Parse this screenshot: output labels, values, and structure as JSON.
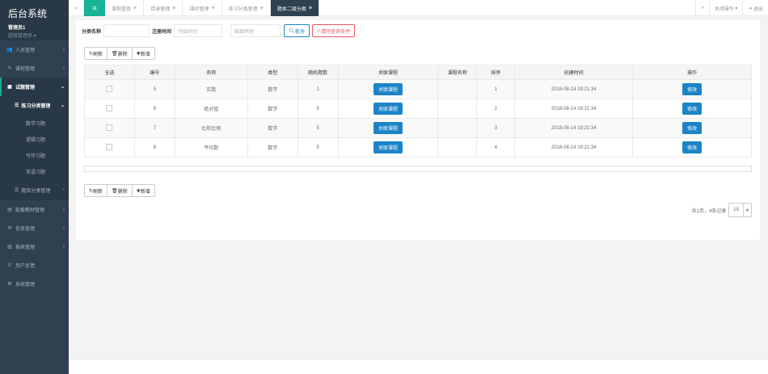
{
  "sidebar": {
    "title": "后台系统",
    "user": "管理员1",
    "role": "超级管理员 ▾",
    "items": [
      {
        "label": "人员管理",
        "icon": "👥"
      },
      {
        "label": "课程管理",
        "icon": "✎"
      },
      {
        "label": "试题管理",
        "icon": "▣"
      }
    ],
    "sub_head": "练习分类管理",
    "sub_items": [
      "数学习题",
      "逻辑习题",
      "写作习题",
      "英语习题"
    ],
    "sub_head2": "题库分类管理",
    "items2": [
      {
        "label": "配套教材管理",
        "icon": "▤"
      },
      {
        "label": "信息管理",
        "icon": "✉"
      },
      {
        "label": "报表管理",
        "icon": "▥"
      },
      {
        "label": "用户反馈",
        "icon": "✆"
      },
      {
        "label": "系统管理",
        "icon": "⚙"
      }
    ]
  },
  "tabs": {
    "items": [
      "课程管理",
      "目录管理",
      "课时管理",
      "练习分类管理"
    ],
    "active": "题本二级分类",
    "close_ops": "关闭操作",
    "logout": "退出"
  },
  "search": {
    "name_label": "分类名称",
    "time_label": "注册时间",
    "start_placeholder": "开始时间",
    "dash": "-",
    "end_placeholder": "结束时间",
    "query_btn": "查询",
    "clear_btn": "清除查询条件"
  },
  "toolbar": {
    "refresh": "刷新",
    "delete": "删除",
    "add": "新增"
  },
  "table": {
    "headers": [
      "全选",
      "编号",
      "名称",
      "类型",
      "随机题数",
      "关联课程",
      "课程名称",
      "排序",
      "创建时间",
      "操作"
    ],
    "link_btn": "关联课程",
    "edit_btn": "修改",
    "rows": [
      {
        "id": "5",
        "name": "实数",
        "type": "数学",
        "count": "1",
        "course": "",
        "sort": "1",
        "created": "2018-08-14 19:21:34"
      },
      {
        "id": "6",
        "name": "绝对值",
        "type": "数学",
        "count": "5",
        "course": "",
        "sort": "2",
        "created": "2018-08-14 19:21:34"
      },
      {
        "id": "7",
        "name": "比和比例",
        "type": "数学",
        "count": "5",
        "course": "",
        "sort": "3",
        "created": "2018-08-14 19:21:34"
      },
      {
        "id": "8",
        "name": "平均数",
        "type": "数学",
        "count": "5",
        "course": "",
        "sort": "4",
        "created": "2018-08-14 19:21:34"
      }
    ]
  },
  "pager": {
    "summary": "共1页，4条记录",
    "page_size": "15"
  }
}
